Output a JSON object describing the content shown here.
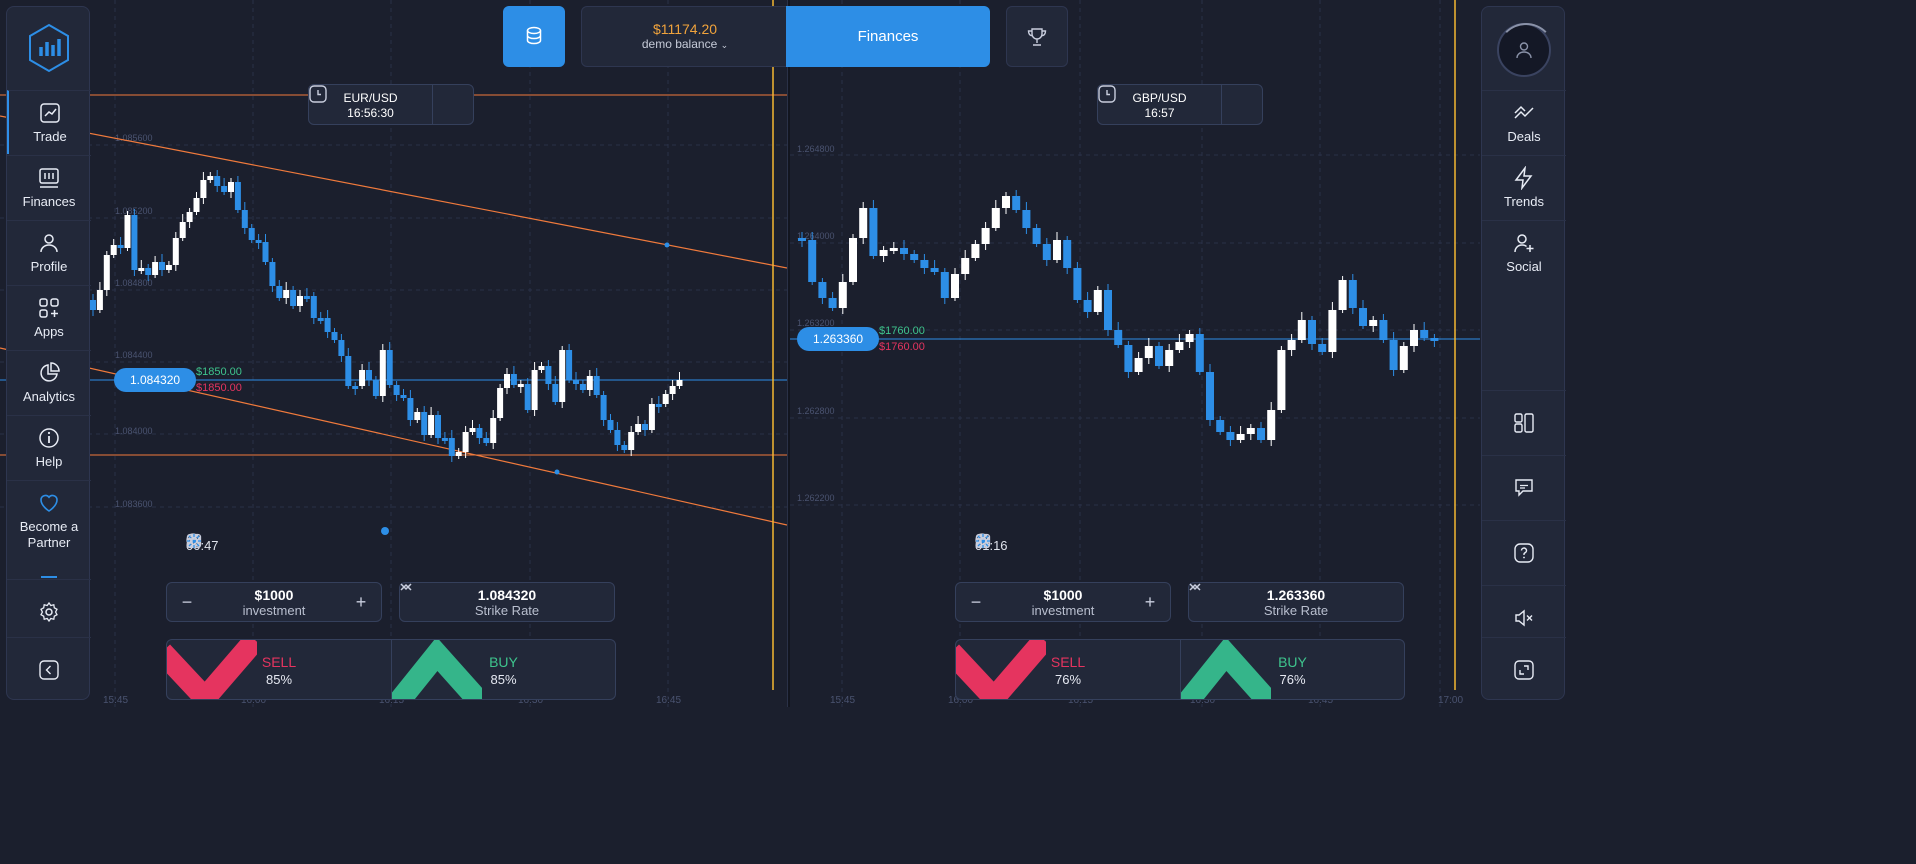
{
  "left_sidebar": {
    "items": [
      {
        "label": "Trade",
        "icon": "trade-icon"
      },
      {
        "label": "Finances",
        "icon": "finances-icon"
      },
      {
        "label": "Profile",
        "icon": "profile-icon"
      },
      {
        "label": "Apps",
        "icon": "apps-icon"
      },
      {
        "label": "Analytics",
        "icon": "analytics-icon"
      },
      {
        "label": "Help",
        "icon": "help-icon"
      },
      {
        "label": "Become a Partner",
        "icon": "heart-icon"
      }
    ]
  },
  "right_sidebar": {
    "items": [
      {
        "label": "Deals",
        "icon": "deals-icon"
      },
      {
        "label": "Trends",
        "icon": "trends-icon"
      },
      {
        "label": "Social",
        "icon": "social-icon"
      }
    ]
  },
  "topbar": {
    "balance": "$11174.20",
    "account": "demo balance",
    "finances_label": "Finances"
  },
  "colors": {
    "accent": "#2d8ee6",
    "sell": "#e5345f",
    "buy": "#3ec48d",
    "balance": "#f0a33c",
    "expiry_line": "#f5b731",
    "trend_line": "#f07a3c"
  },
  "charts": [
    {
      "pair": "EUR/USD",
      "time": "16:56:30",
      "current_price": "1.084320",
      "profit_up": "$1850.00",
      "profit_down": "$1850.00",
      "timer": "00:47",
      "investment": "$1000",
      "investment_label": "investment",
      "strike": "1.084320",
      "strike_label": "Strike Rate",
      "sell_label": "SELL",
      "sell_pct": "85%",
      "buy_label": "BUY",
      "buy_pct": "85%",
      "y_ticks": [
        "1.085600",
        "1.085200",
        "1.084800",
        "1.084400",
        "1.084000",
        "1.083600"
      ],
      "x_ticks": [
        "15:45",
        "16:00",
        "16:15",
        "16:30",
        "16:45"
      ]
    },
    {
      "pair": "GBP/USD",
      "time": "16:57",
      "current_price": "1.263360",
      "profit_up": "$1760.00",
      "profit_down": "$1760.00",
      "timer": "01:16",
      "investment": "$1000",
      "investment_label": "investment",
      "strike": "1.263360",
      "strike_label": "Strike Rate",
      "sell_label": "SELL",
      "sell_pct": "76%",
      "buy_label": "BUY",
      "buy_pct": "76%",
      "y_ticks": [
        "1.264800",
        "1.264000",
        "1.263200",
        "1.262800",
        "1.262200"
      ],
      "x_ticks": [
        "15:45",
        "16:00",
        "16:15",
        "16:30",
        "16:45",
        "17:00"
      ]
    }
  ]
}
